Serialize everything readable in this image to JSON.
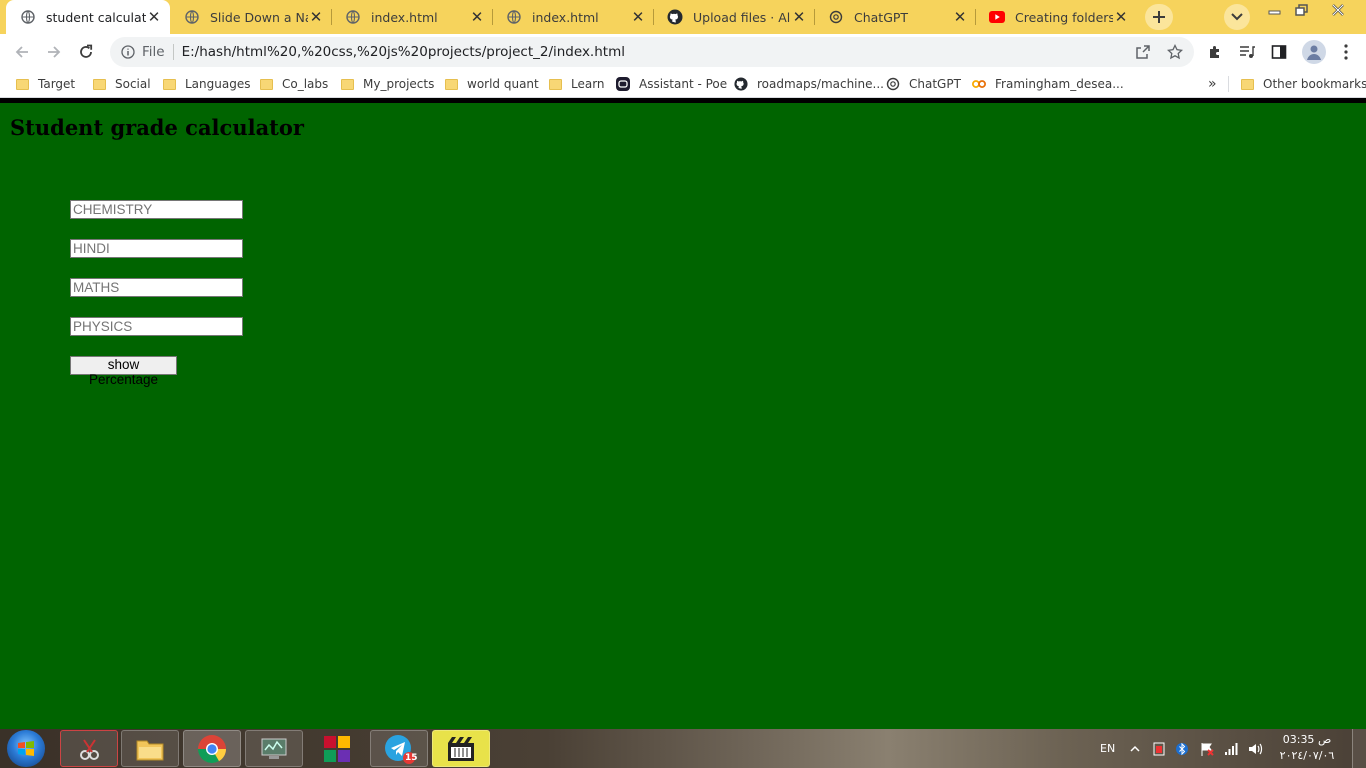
{
  "browser": {
    "tabs": [
      {
        "title": "student calculate",
        "icon": "globe-icon",
        "active": true
      },
      {
        "title": "Slide Down a Navi",
        "icon": "globe-icon",
        "active": false
      },
      {
        "title": "index.html",
        "icon": "globe-icon",
        "active": false
      },
      {
        "title": "index.html",
        "icon": "globe-icon",
        "active": false
      },
      {
        "title": "Upload files · Allan",
        "icon": "github-icon",
        "active": false
      },
      {
        "title": "ChatGPT",
        "icon": "chatgpt-icon",
        "active": false
      },
      {
        "title": "Creating folders a",
        "icon": "youtube-icon",
        "active": false
      }
    ],
    "address": {
      "scheme_label": "File",
      "url": "E:/hash/html%20,%20css,%20js%20projects/project_2/index.html"
    },
    "bookmarks": [
      {
        "label": "Target",
        "icon": "folder-icon"
      },
      {
        "label": "Social",
        "icon": "folder-icon"
      },
      {
        "label": "Languages",
        "icon": "folder-icon"
      },
      {
        "label": "Co_labs",
        "icon": "folder-icon"
      },
      {
        "label": "My_projects",
        "icon": "folder-icon"
      },
      {
        "label": "world quant",
        "icon": "folder-icon"
      },
      {
        "label": "Learn",
        "icon": "folder-icon"
      },
      {
        "label": "Assistant - Poe",
        "icon": "poe-icon"
      },
      {
        "label": "roadmaps/machine...",
        "icon": "github-icon"
      },
      {
        "label": "ChatGPT",
        "icon": "chatgpt-icon"
      },
      {
        "label": "Framingham_desea...",
        "icon": "colab-icon"
      }
    ],
    "other_bookmarks": "Other bookmarks"
  },
  "page": {
    "background": "#006400",
    "title": "Student grade calculator",
    "inputs": [
      {
        "placeholder": "CHEMISTRY"
      },
      {
        "placeholder": "HINDI"
      },
      {
        "placeholder": "MATHS"
      },
      {
        "placeholder": "PHYSICS"
      }
    ],
    "button_label": "show Percentage"
  },
  "taskbar": {
    "apps": [
      "snipping-tool-icon",
      "file-explorer-icon",
      "chrome-icon",
      "system-monitor-icon",
      "office-icon",
      "telegram-icon",
      "media-player-icon"
    ],
    "telegram_badge": "15",
    "language": "EN",
    "time": "03:35 ص",
    "date": "٢٠٢٤/٠٧/٠٦"
  }
}
